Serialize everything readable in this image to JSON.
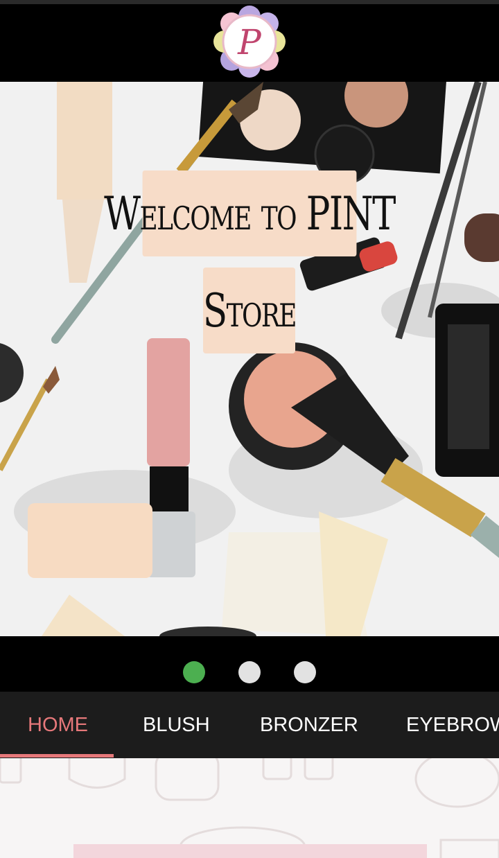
{
  "app": {
    "logo_letter": "P"
  },
  "hero": {
    "welcome_text": "Welcome to PINT",
    "store_text": "Store"
  },
  "pager": {
    "count": 3,
    "active_index": 0
  },
  "tabs": [
    {
      "label": "HOME",
      "active": true
    },
    {
      "label": "BLUSH",
      "active": false
    },
    {
      "label": "BRONZER",
      "active": false
    },
    {
      "label": "EYEBROW",
      "active": false
    }
  ],
  "colors": {
    "accent": "#e6787a",
    "active_dot": "#4caf50",
    "label_bg": "#f7dcc8",
    "tabbar_bg": "#1c1c1c"
  }
}
